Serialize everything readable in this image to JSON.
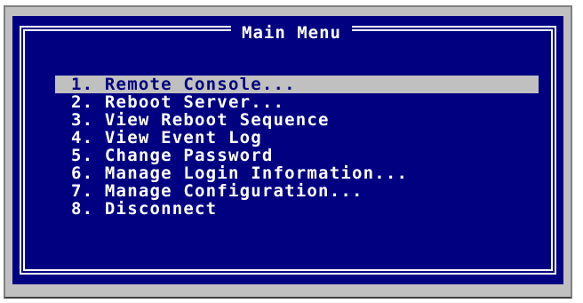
{
  "menu": {
    "title": "Main Menu",
    "items": [
      {
        "label": "1. Remote Console..."
      },
      {
        "label": "2. Reboot Server..."
      },
      {
        "label": "3. View Reboot Sequence"
      },
      {
        "label": "4. View Event Log"
      },
      {
        "label": "5. Change Password"
      },
      {
        "label": "6. Manage Login Information..."
      },
      {
        "label": "7. Manage Configuration..."
      },
      {
        "label": "8. Disconnect"
      }
    ],
    "selected_index": 0
  },
  "colors": {
    "screen_background": "#000080",
    "text": "#ffffff",
    "highlight_background": "#c0c0c0",
    "highlight_text": "#000080"
  }
}
